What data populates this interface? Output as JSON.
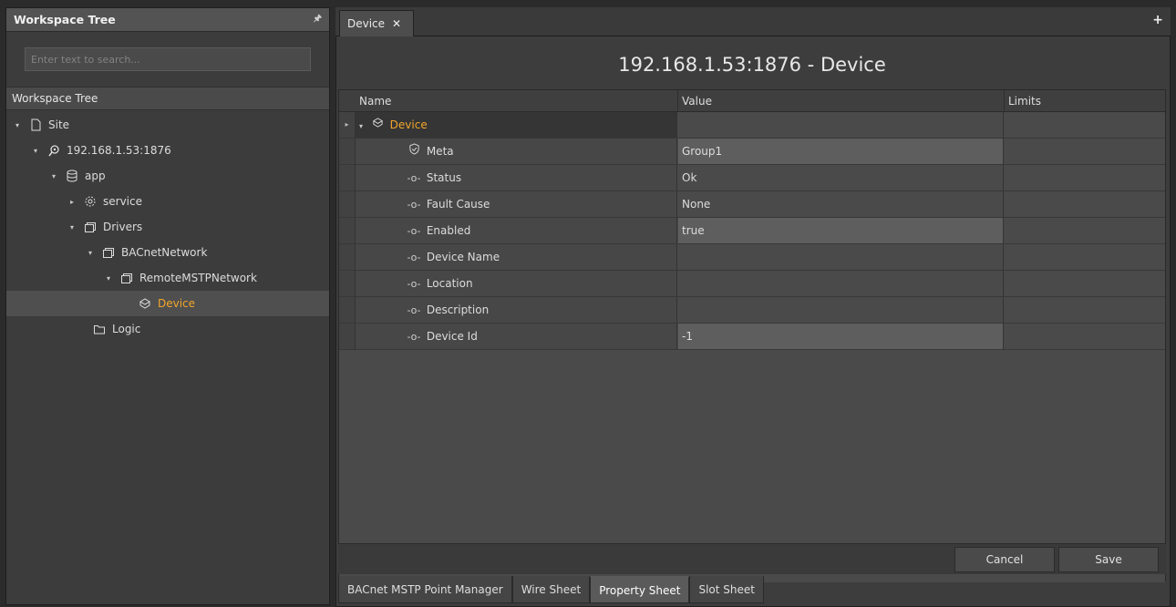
{
  "left_panel": {
    "title": "Workspace Tree",
    "pin_icon": "pin-icon",
    "search_placeholder": "Enter text to search...",
    "tree_header": "Workspace Tree",
    "nodes": [
      {
        "label": "Site",
        "icon": "page-icon",
        "arrow": "expanded"
      },
      {
        "label": "192.168.1.53:1876",
        "icon": "connection-icon",
        "arrow": "expanded"
      },
      {
        "label": "app",
        "icon": "database-icon",
        "arrow": "expanded"
      },
      {
        "label": "service",
        "icon": "gear-icon",
        "arrow": "collapsed"
      },
      {
        "label": "Drivers",
        "icon": "stack-icon",
        "arrow": "expanded"
      },
      {
        "label": "BACnetNetwork",
        "icon": "stack-icon",
        "arrow": "expanded"
      },
      {
        "label": "RemoteMSTPNetwork",
        "icon": "stack-icon",
        "arrow": "expanded"
      },
      {
        "label": "Device",
        "icon": "device-icon",
        "arrow": "none",
        "selected": true
      },
      {
        "label": "Logic",
        "icon": "folder-icon",
        "arrow": "none"
      }
    ]
  },
  "tabs": {
    "active_label": "Device",
    "close_icon": "close-icon",
    "add_icon": "plus-icon"
  },
  "main": {
    "title": "192.168.1.53:1876 - Device",
    "columns": {
      "name": "Name",
      "value": "Value",
      "limits": "Limits"
    },
    "rows": [
      {
        "name": "Device",
        "value": "",
        "icon": "device-icon",
        "kind": "parent"
      },
      {
        "name": "Meta",
        "value": "Group1",
        "icon": "shield-check-icon",
        "editable": true
      },
      {
        "name": "Status",
        "value": "Ok",
        "icon": "slot-icon"
      },
      {
        "name": "Fault Cause",
        "value": "None",
        "icon": "slot-icon"
      },
      {
        "name": "Enabled",
        "value": "true",
        "icon": "slot-icon",
        "editable": true
      },
      {
        "name": "Device Name",
        "value": "",
        "icon": "slot-icon"
      },
      {
        "name": "Location",
        "value": "",
        "icon": "slot-icon"
      },
      {
        "name": "Description",
        "value": "",
        "icon": "slot-icon"
      },
      {
        "name": "Device Id",
        "value": "-1",
        "icon": "slot-icon",
        "editable": true
      }
    ],
    "buttons": {
      "cancel": "Cancel",
      "save": "Save"
    },
    "view_tabs": [
      {
        "label": "BACnet MSTP Point Manager",
        "active": false
      },
      {
        "label": "Wire Sheet",
        "active": false
      },
      {
        "label": "Property Sheet",
        "active": true
      },
      {
        "label": "Slot Sheet",
        "active": false
      }
    ]
  },
  "colors": {
    "selected_text": "#f2a62b",
    "background": "#2b2b2b"
  }
}
